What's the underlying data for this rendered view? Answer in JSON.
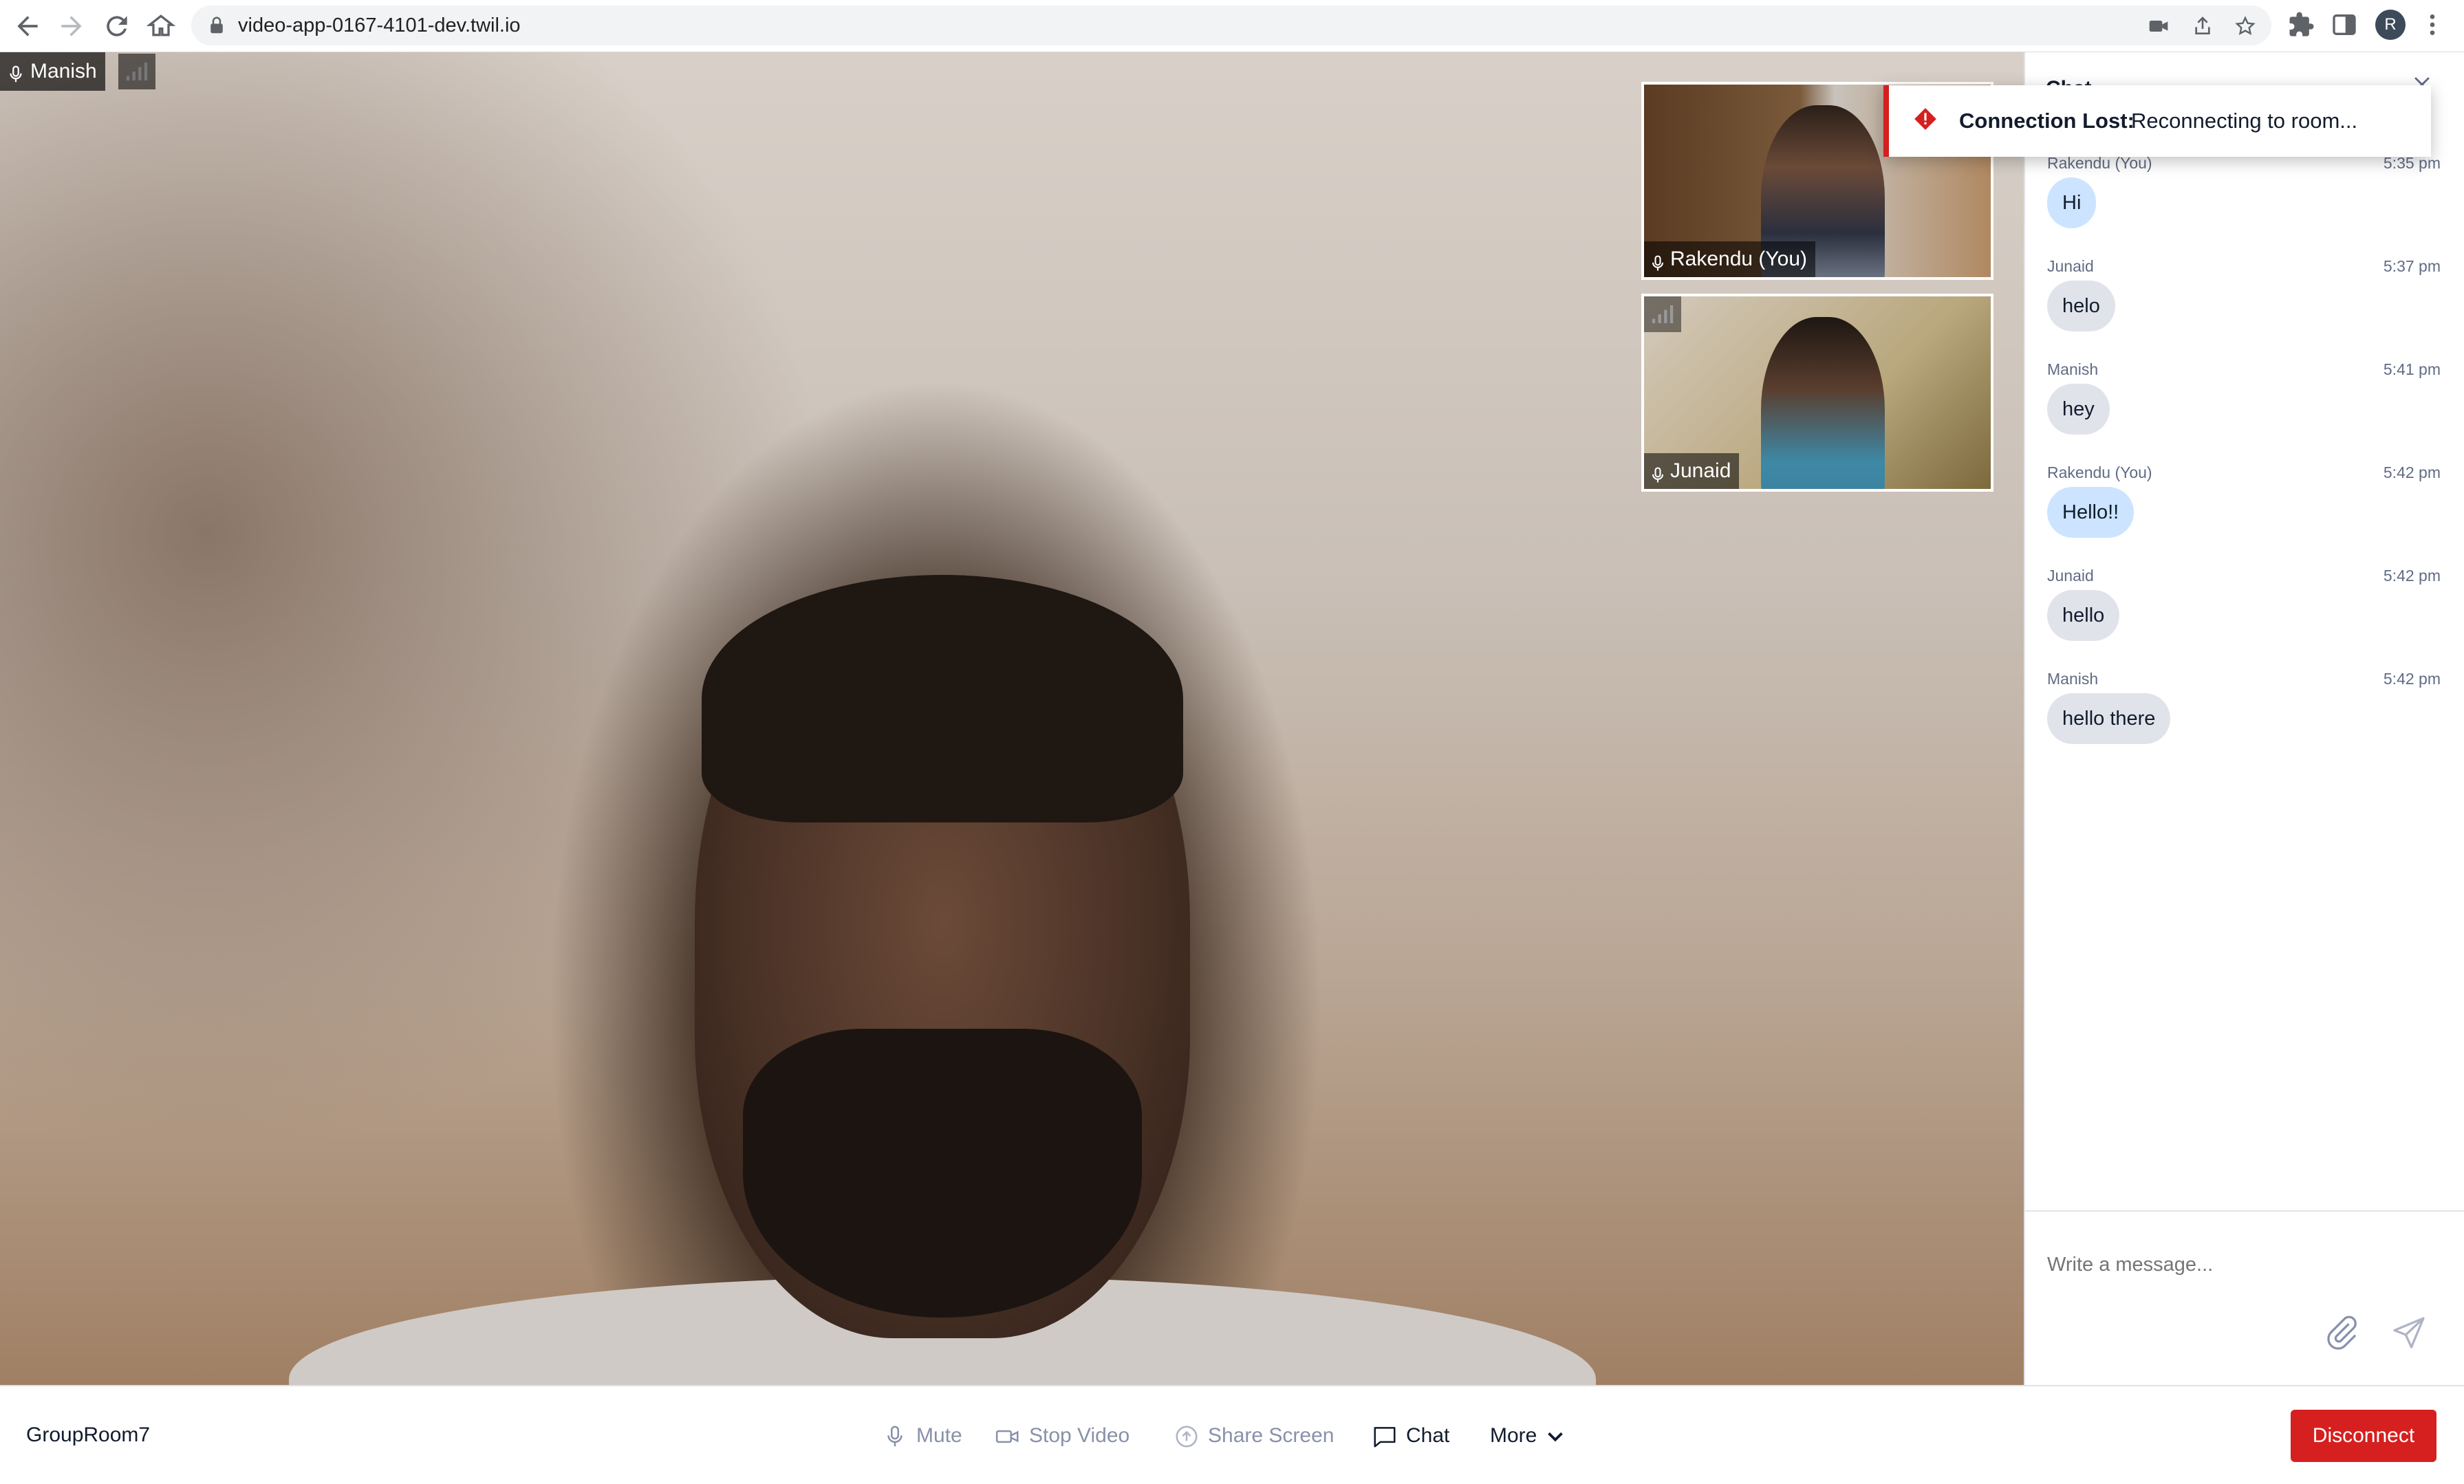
{
  "browser": {
    "url": "video-app-0167-4101-dev.twil.io",
    "profile_initial": "R",
    "icons": [
      "back-icon",
      "forward-icon",
      "reload-icon",
      "home-icon",
      "lock-icon",
      "camera-icon",
      "share-icon",
      "star-icon",
      "extensions-icon",
      "side-panel-icon",
      "menu-icon"
    ]
  },
  "main_video": {
    "participant": "Manish"
  },
  "tiles": [
    {
      "name": "Rakendu (You)"
    },
    {
      "name": "Junaid"
    }
  ],
  "toast": {
    "title": "Connection Lost:",
    "message": "Reconnecting to room...",
    "accent_color": "#d61f1f"
  },
  "chat": {
    "header": "Chat",
    "messages": [
      {
        "author": "Rakendu (You)",
        "time": "5:35 pm",
        "text": "Hi",
        "self": true
      },
      {
        "author": "Junaid",
        "time": "5:37 pm",
        "text": "helo",
        "self": false
      },
      {
        "author": "Manish",
        "time": "5:41 pm",
        "text": "hey",
        "self": false
      },
      {
        "author": "Rakendu (You)",
        "time": "5:42 pm",
        "text": "Hello!!",
        "self": true
      },
      {
        "author": "Junaid",
        "time": "5:42 pm",
        "text": "hello",
        "self": false
      },
      {
        "author": "Manish",
        "time": "5:42 pm",
        "text": "hello there",
        "self": false
      }
    ],
    "input_placeholder": "Write a message..."
  },
  "bottombar": {
    "room_name": "GroupRoom7",
    "mute_label": "Mute",
    "stop_video_label": "Stop Video",
    "share_screen_label": "Share Screen",
    "chat_label": "Chat",
    "more_label": "More",
    "disconnect_label": "Disconnect",
    "disconnect_color": "#d61f1f"
  }
}
